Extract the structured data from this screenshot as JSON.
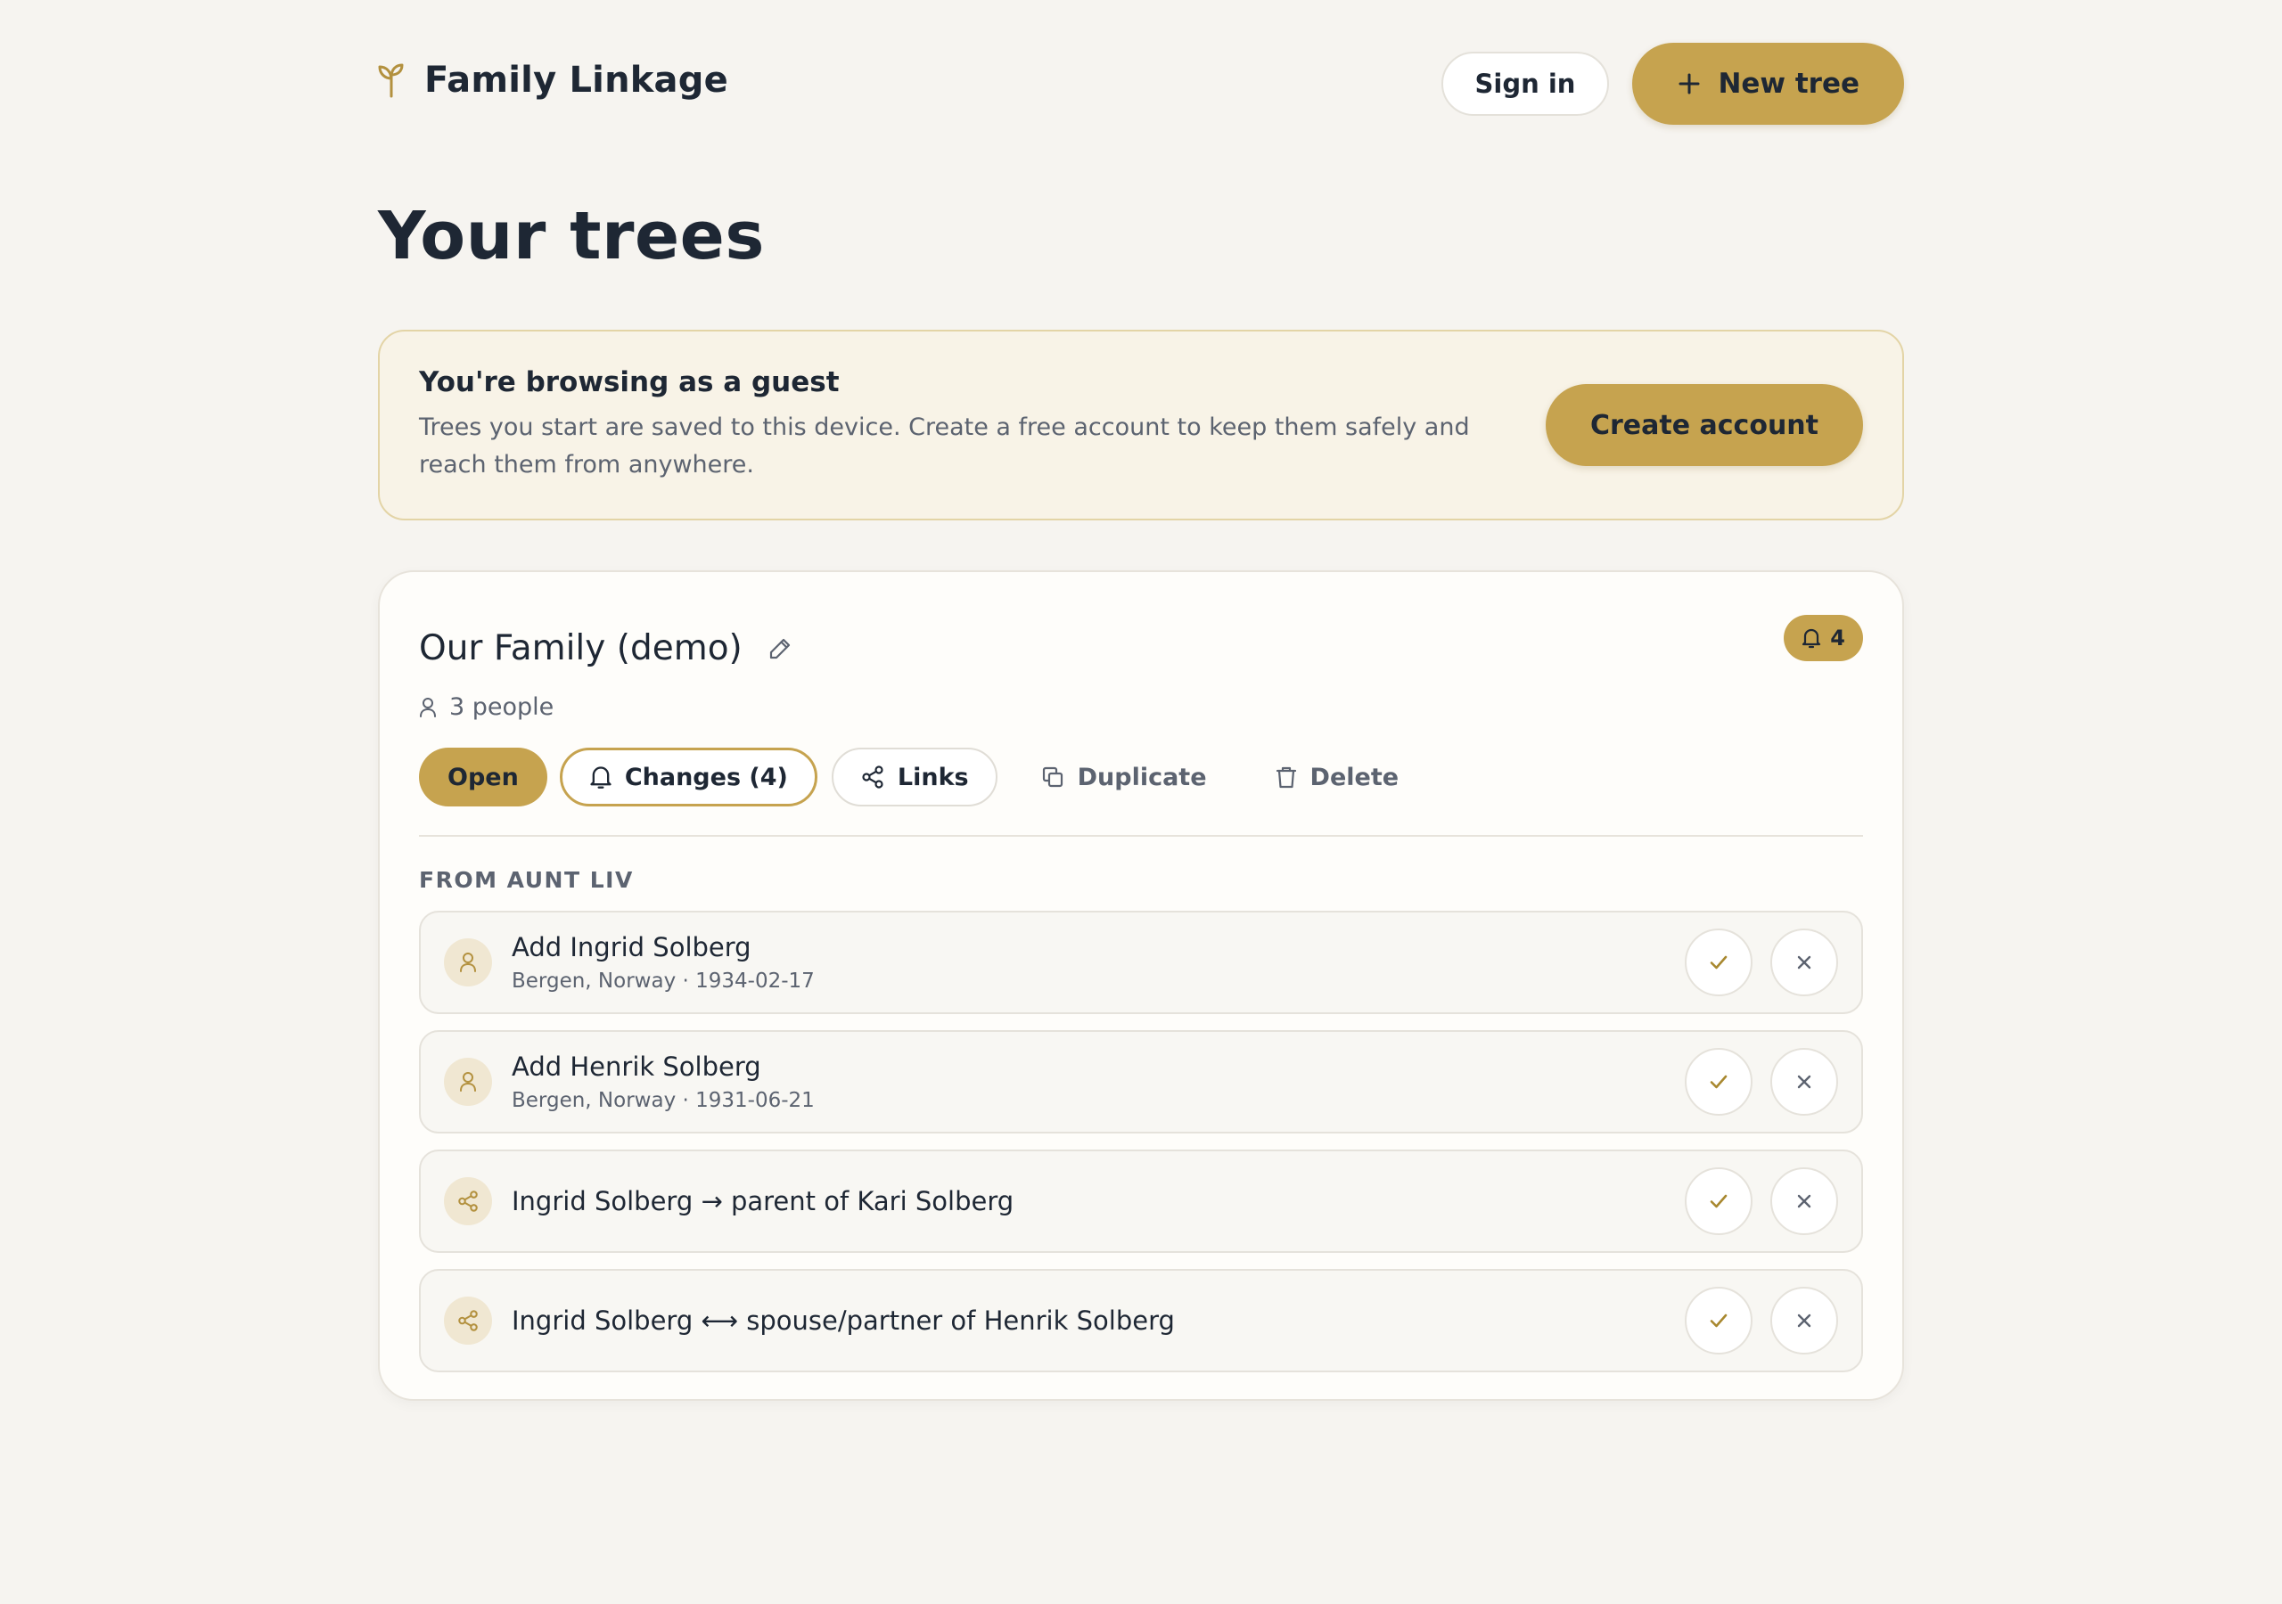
{
  "app": {
    "name": "Family Linkage",
    "sign_in_label": "Sign in",
    "new_tree_label": "New tree",
    "accent_color": "#c6a34f"
  },
  "page": {
    "title": "Your trees"
  },
  "guest_banner": {
    "title": "You're browsing as a guest",
    "body": "Trees you start are saved to this device. Create a free account to keep them safely and reach them from anywhere.",
    "button_label": "Create account"
  },
  "tree": {
    "name": "Our Family (demo)",
    "notification_count": "4",
    "people_count": "3 people",
    "actions": {
      "open": "Open",
      "changes": "Changes (4)",
      "links": "Links",
      "duplicate": "Duplicate",
      "delete": "Delete"
    },
    "changes_source": "FROM AUNT LIV",
    "changes": [
      {
        "icon": "person-icon",
        "title": "Add Ingrid Solberg",
        "subtitle": "Bergen, Norway · 1934-02-17"
      },
      {
        "icon": "person-icon",
        "title": "Add Henrik Solberg",
        "subtitle": "Bergen, Norway · 1931-06-21"
      },
      {
        "icon": "share-icon",
        "title": "Ingrid Solberg → parent of Kari Solberg",
        "subtitle": ""
      },
      {
        "icon": "share-icon",
        "title": "Ingrid Solberg ⟷ spouse/partner of Henrik Solberg",
        "subtitle": ""
      }
    ]
  }
}
